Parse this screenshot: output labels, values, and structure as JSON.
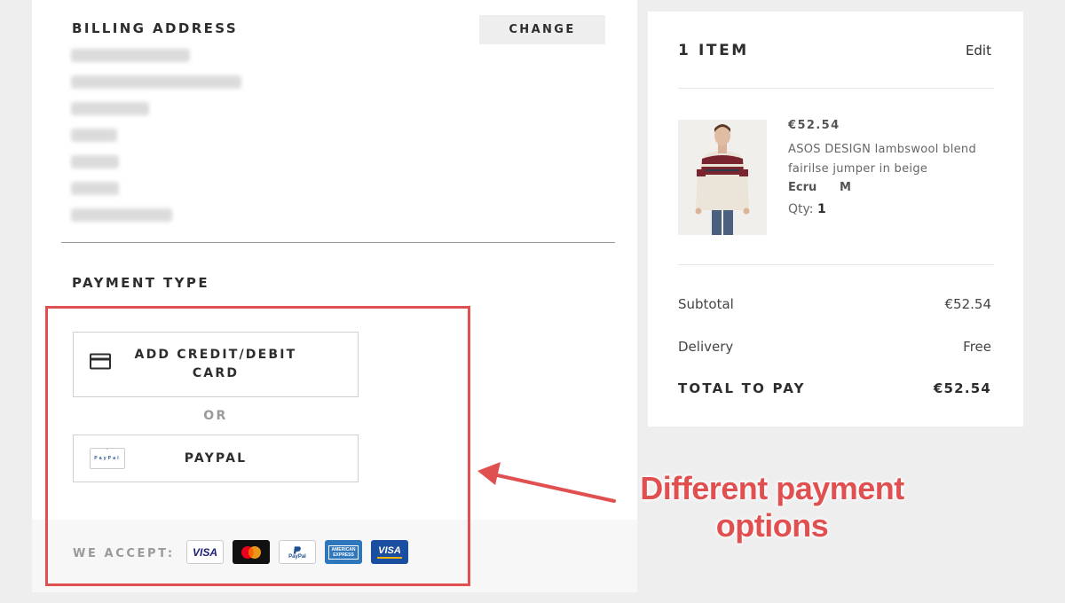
{
  "billing": {
    "heading": "BILLING ADDRESS",
    "change_label": "CHANGE"
  },
  "payment": {
    "heading": "PAYMENT TYPE",
    "card_option_line1": "ADD CREDIT/DEBIT",
    "card_option_line2": "CARD",
    "or_label": "OR",
    "paypal_option": "PAYPAL",
    "paypal_icon_text": "PayPal",
    "accept_label": "WE ACCEPT:",
    "card_logos": [
      {
        "icon": "visa-icon",
        "text": "VISA"
      },
      {
        "icon": "mastercard-icon",
        "text": ""
      },
      {
        "icon": "paypal-icon",
        "text": "PayPal"
      },
      {
        "icon": "amex-icon",
        "text": "AMERICAN EXPRESS"
      },
      {
        "icon": "visa-electron-icon",
        "text": "VISA"
      }
    ]
  },
  "summary": {
    "item_count": "1 ITEM",
    "edit_label": "Edit",
    "product": {
      "price": "€52.54",
      "name": "ASOS DESIGN lambswool blend fairilse jumper in beige",
      "colour": "Ecru",
      "size": "M",
      "qty_label": "Qty:",
      "qty_value": "1"
    },
    "subtotal_label": "Subtotal",
    "subtotal_value": "€52.54",
    "delivery_label": "Delivery",
    "delivery_value": "Free",
    "total_label": "TOTAL TO PAY",
    "total_value": "€52.54"
  },
  "annotation": {
    "line1": "Different payment",
    "line2": "options"
  },
  "colors": {
    "highlight": "#e05050",
    "page_bg": "#eeeeee",
    "text": "#2d2d2d"
  }
}
